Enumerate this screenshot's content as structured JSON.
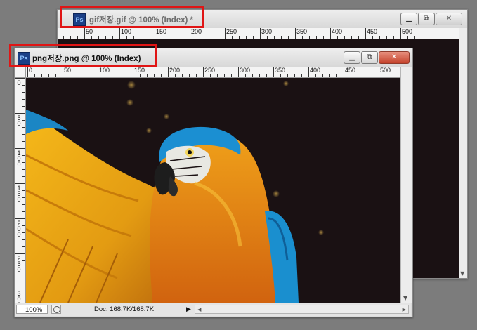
{
  "windows": {
    "back": {
      "title": "gif저장.gif @ 100% (Index) *",
      "icon_label": "Ps",
      "ruler_labels": [
        "50",
        "100",
        "150",
        "200",
        "250",
        "300",
        "350",
        "400",
        "450",
        "500"
      ],
      "controls": {
        "minimize": "▁",
        "restore": "⧉",
        "close": "✕"
      }
    },
    "front": {
      "title": "png저장.png @ 100% (Index)",
      "icon_label": "Ps",
      "ruler_labels": [
        "0",
        "50",
        "100",
        "150",
        "200",
        "250",
        "300",
        "350",
        "400",
        "450",
        "500"
      ],
      "vruler_labels": [
        "0",
        "50",
        "100",
        "150",
        "200",
        "250",
        "300"
      ],
      "controls": {
        "minimize": "▁",
        "restore": "⧉",
        "close": "✕"
      },
      "status": {
        "zoom": "100%",
        "doc_info": "Doc: 168.7K/168.7K",
        "arrow": "▶",
        "scroll_left": "◀",
        "scroll_right": "▶"
      }
    }
  },
  "colors": {
    "annotation_box": "#e01515",
    "canvas_bg": "#1a1113",
    "close_button": "#c5432c"
  }
}
